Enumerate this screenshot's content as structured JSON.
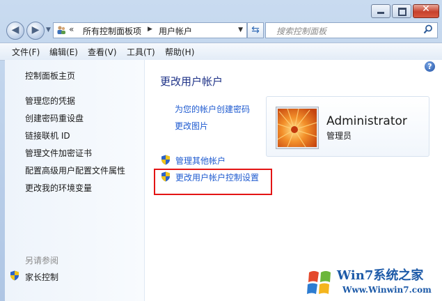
{
  "window": {
    "caption": {
      "minimize": "minimize",
      "maximize": "maximize",
      "close": "✕"
    }
  },
  "nav": {
    "back_icon": "◀",
    "forward_icon": "▶",
    "address": {
      "prefix": "«",
      "crumbs": [
        "所有控制面板项",
        "用户帐户"
      ]
    },
    "search": {
      "placeholder": "搜索控制面板"
    }
  },
  "menu": [
    "文件(F)",
    "编辑(E)",
    "查看(V)",
    "工具(T)",
    "帮助(H)"
  ],
  "sidebar": {
    "items": [
      "控制面板主页",
      "管理您的凭据",
      "创建密码重设盘",
      "链接联机 ID",
      "管理文件加密证书",
      "配置高级用户配置文件属性",
      "更改我的环境变量"
    ],
    "see_also": "另请参阅",
    "see_also_items": [
      "家长控制"
    ]
  },
  "main": {
    "title": "更改用户帐户",
    "links": [
      "为您的帐户创建密码",
      "更改图片"
    ],
    "shield_links": [
      "管理其他帐户",
      "更改用户帐户控制设置"
    ],
    "help": "?"
  },
  "account": {
    "name": "Administrator",
    "role": "管理员"
  },
  "watermark": {
    "brand": "Win7系统之家",
    "url": "Www.Winwin7.com"
  },
  "colors": {
    "title": "#1e3287",
    "link": "#1f5bd0",
    "highlight": "#e31414"
  }
}
